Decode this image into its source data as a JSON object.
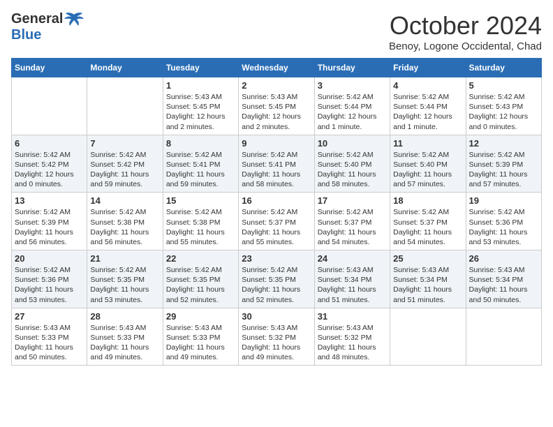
{
  "header": {
    "logo_general": "General",
    "logo_blue": "Blue",
    "month_title": "October 2024",
    "subtitle": "Benoy, Logone Occidental, Chad"
  },
  "days_of_week": [
    "Sunday",
    "Monday",
    "Tuesday",
    "Wednesday",
    "Thursday",
    "Friday",
    "Saturday"
  ],
  "weeks": [
    [
      {
        "day": "",
        "info": ""
      },
      {
        "day": "",
        "info": ""
      },
      {
        "day": "1",
        "info": "Sunrise: 5:43 AM\nSunset: 5:45 PM\nDaylight: 12 hours\nand 2 minutes."
      },
      {
        "day": "2",
        "info": "Sunrise: 5:43 AM\nSunset: 5:45 PM\nDaylight: 12 hours\nand 2 minutes."
      },
      {
        "day": "3",
        "info": "Sunrise: 5:42 AM\nSunset: 5:44 PM\nDaylight: 12 hours\nand 1 minute."
      },
      {
        "day": "4",
        "info": "Sunrise: 5:42 AM\nSunset: 5:44 PM\nDaylight: 12 hours\nand 1 minute."
      },
      {
        "day": "5",
        "info": "Sunrise: 5:42 AM\nSunset: 5:43 PM\nDaylight: 12 hours\nand 0 minutes."
      }
    ],
    [
      {
        "day": "6",
        "info": "Sunrise: 5:42 AM\nSunset: 5:42 PM\nDaylight: 12 hours\nand 0 minutes."
      },
      {
        "day": "7",
        "info": "Sunrise: 5:42 AM\nSunset: 5:42 PM\nDaylight: 11 hours\nand 59 minutes."
      },
      {
        "day": "8",
        "info": "Sunrise: 5:42 AM\nSunset: 5:41 PM\nDaylight: 11 hours\nand 59 minutes."
      },
      {
        "day": "9",
        "info": "Sunrise: 5:42 AM\nSunset: 5:41 PM\nDaylight: 11 hours\nand 58 minutes."
      },
      {
        "day": "10",
        "info": "Sunrise: 5:42 AM\nSunset: 5:40 PM\nDaylight: 11 hours\nand 58 minutes."
      },
      {
        "day": "11",
        "info": "Sunrise: 5:42 AM\nSunset: 5:40 PM\nDaylight: 11 hours\nand 57 minutes."
      },
      {
        "day": "12",
        "info": "Sunrise: 5:42 AM\nSunset: 5:39 PM\nDaylight: 11 hours\nand 57 minutes."
      }
    ],
    [
      {
        "day": "13",
        "info": "Sunrise: 5:42 AM\nSunset: 5:39 PM\nDaylight: 11 hours\nand 56 minutes."
      },
      {
        "day": "14",
        "info": "Sunrise: 5:42 AM\nSunset: 5:38 PM\nDaylight: 11 hours\nand 56 minutes."
      },
      {
        "day": "15",
        "info": "Sunrise: 5:42 AM\nSunset: 5:38 PM\nDaylight: 11 hours\nand 55 minutes."
      },
      {
        "day": "16",
        "info": "Sunrise: 5:42 AM\nSunset: 5:37 PM\nDaylight: 11 hours\nand 55 minutes."
      },
      {
        "day": "17",
        "info": "Sunrise: 5:42 AM\nSunset: 5:37 PM\nDaylight: 11 hours\nand 54 minutes."
      },
      {
        "day": "18",
        "info": "Sunrise: 5:42 AM\nSunset: 5:37 PM\nDaylight: 11 hours\nand 54 minutes."
      },
      {
        "day": "19",
        "info": "Sunrise: 5:42 AM\nSunset: 5:36 PM\nDaylight: 11 hours\nand 53 minutes."
      }
    ],
    [
      {
        "day": "20",
        "info": "Sunrise: 5:42 AM\nSunset: 5:36 PM\nDaylight: 11 hours\nand 53 minutes."
      },
      {
        "day": "21",
        "info": "Sunrise: 5:42 AM\nSunset: 5:35 PM\nDaylight: 11 hours\nand 53 minutes."
      },
      {
        "day": "22",
        "info": "Sunrise: 5:42 AM\nSunset: 5:35 PM\nDaylight: 11 hours\nand 52 minutes."
      },
      {
        "day": "23",
        "info": "Sunrise: 5:42 AM\nSunset: 5:35 PM\nDaylight: 11 hours\nand 52 minutes."
      },
      {
        "day": "24",
        "info": "Sunrise: 5:43 AM\nSunset: 5:34 PM\nDaylight: 11 hours\nand 51 minutes."
      },
      {
        "day": "25",
        "info": "Sunrise: 5:43 AM\nSunset: 5:34 PM\nDaylight: 11 hours\nand 51 minutes."
      },
      {
        "day": "26",
        "info": "Sunrise: 5:43 AM\nSunset: 5:34 PM\nDaylight: 11 hours\nand 50 minutes."
      }
    ],
    [
      {
        "day": "27",
        "info": "Sunrise: 5:43 AM\nSunset: 5:33 PM\nDaylight: 11 hours\nand 50 minutes."
      },
      {
        "day": "28",
        "info": "Sunrise: 5:43 AM\nSunset: 5:33 PM\nDaylight: 11 hours\nand 49 minutes."
      },
      {
        "day": "29",
        "info": "Sunrise: 5:43 AM\nSunset: 5:33 PM\nDaylight: 11 hours\nand 49 minutes."
      },
      {
        "day": "30",
        "info": "Sunrise: 5:43 AM\nSunset: 5:32 PM\nDaylight: 11 hours\nand 49 minutes."
      },
      {
        "day": "31",
        "info": "Sunrise: 5:43 AM\nSunset: 5:32 PM\nDaylight: 11 hours\nand 48 minutes."
      },
      {
        "day": "",
        "info": ""
      },
      {
        "day": "",
        "info": ""
      }
    ]
  ]
}
